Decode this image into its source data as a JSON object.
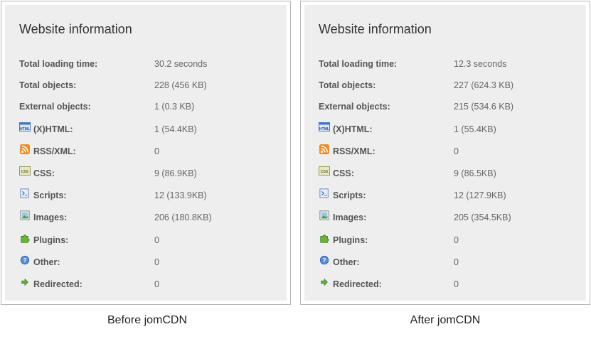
{
  "panels": [
    {
      "title": "Website information",
      "rows": [
        {
          "label": "Total loading time:",
          "value": "30.2 seconds"
        },
        {
          "label": "Total objects:",
          "value": "228 (456 KB)"
        },
        {
          "label": "External objects:",
          "value": "1 (0.3 KB)"
        },
        {
          "label": "(X)HTML:",
          "value": "1 (54.4KB)",
          "icon": "html-icon"
        },
        {
          "label": "RSS/XML:",
          "value": "0",
          "icon": "rss-icon"
        },
        {
          "label": "CSS:",
          "value": "9 (86.9KB)",
          "icon": "css-icon"
        },
        {
          "label": "Scripts:",
          "value": "12 (133.9KB)",
          "icon": "script-icon"
        },
        {
          "label": "Images:",
          "value": "206 (180.8KB)",
          "icon": "image-icon"
        },
        {
          "label": "Plugins:",
          "value": "0",
          "icon": "puzzle-icon"
        },
        {
          "label": "Other:",
          "value": "0",
          "icon": "question-icon"
        },
        {
          "label": "Redirected:",
          "value": "0",
          "icon": "arrow-right-icon"
        }
      ],
      "caption": "Before jomCDN"
    },
    {
      "title": "Website information",
      "rows": [
        {
          "label": "Total loading time:",
          "value": "12.3 seconds"
        },
        {
          "label": "Total objects:",
          "value": "227 (624.3 KB)"
        },
        {
          "label": "External objects:",
          "value": "215 (534.6 KB)"
        },
        {
          "label": "(X)HTML:",
          "value": "1 (55.4KB)",
          "icon": "html-icon"
        },
        {
          "label": "RSS/XML:",
          "value": "0",
          "icon": "rss-icon"
        },
        {
          "label": "CSS:",
          "value": "9 (86.5KB)",
          "icon": "css-icon"
        },
        {
          "label": "Scripts:",
          "value": "12 (127.9KB)",
          "icon": "script-icon"
        },
        {
          "label": "Images:",
          "value": "205 (354.5KB)",
          "icon": "image-icon"
        },
        {
          "label": "Plugins:",
          "value": "0",
          "icon": "puzzle-icon"
        },
        {
          "label": "Other:",
          "value": "0",
          "icon": "question-icon"
        },
        {
          "label": "Redirected:",
          "value": "0",
          "icon": "arrow-right-icon"
        }
      ],
      "caption": "After jomCDN"
    }
  ]
}
